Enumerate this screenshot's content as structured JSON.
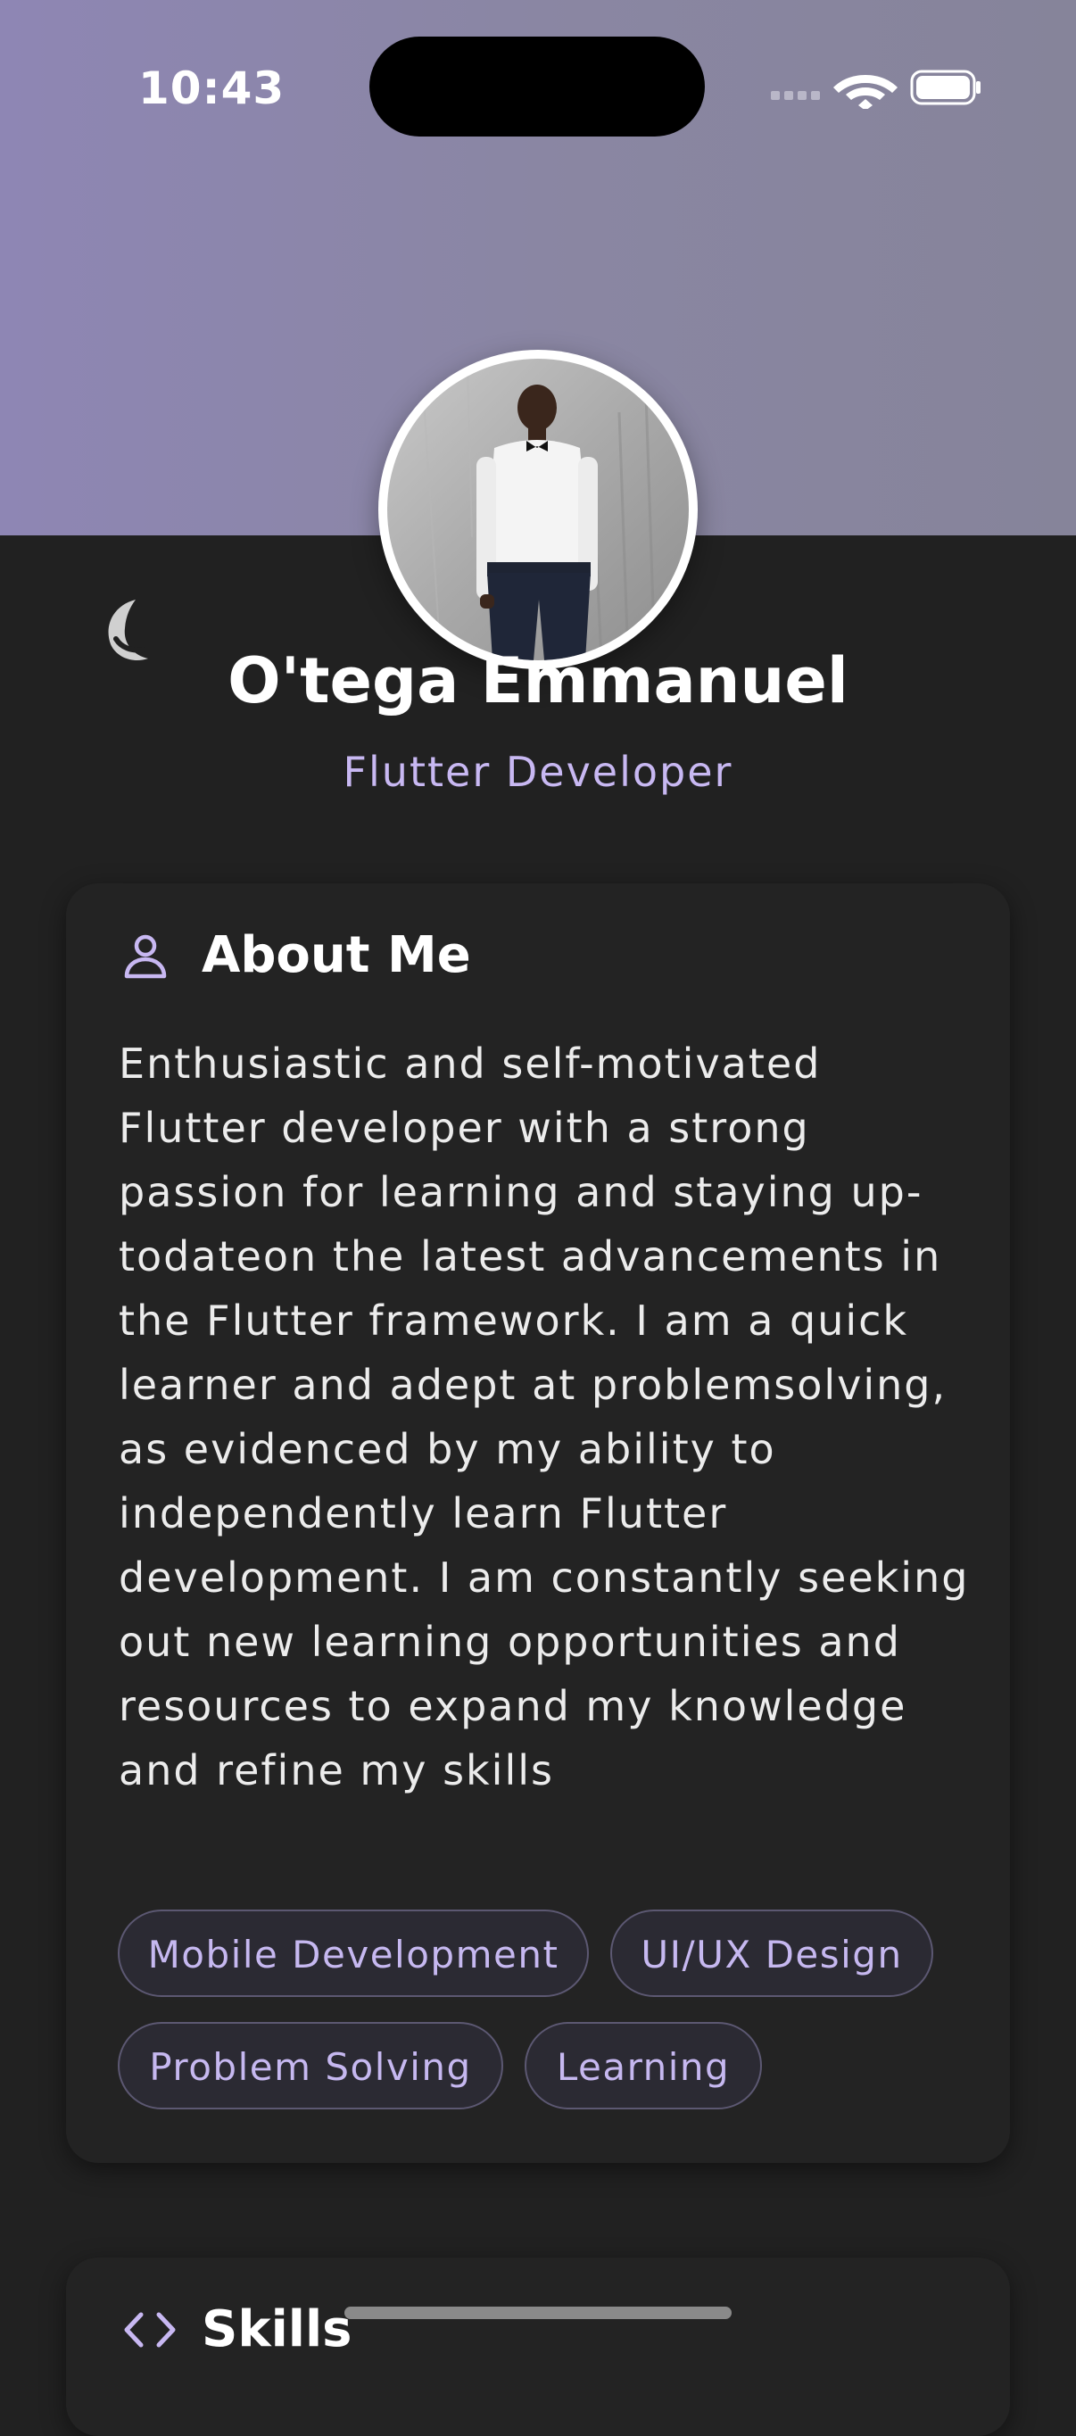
{
  "status_bar": {
    "time": "10:43"
  },
  "profile": {
    "name": "O'tega Emmanuel",
    "role": "Flutter Developer"
  },
  "about": {
    "title": "About Me",
    "icon": "person-icon",
    "text": "Enthusiastic and self-motivated Flutter developer with a strong passion for learning and staying up-todateon the latest advancements in the Flutter framework. I am a quick learner and adept at problemsolving, as evidenced by my ability to independently learn Flutter development. I am constantly seeking out new learning opportunities and resources to expand my knowledge and refine my skills",
    "tags": [
      "Mobile Development",
      "UI/UX Design",
      "Problem Solving",
      "Learning"
    ]
  },
  "skills": {
    "title": "Skills",
    "icon": "code-icon"
  },
  "theme": {
    "accent": "#c8b8f2",
    "background": "#212121",
    "header_gradient_start": "#8e86b4",
    "header_gradient_end": "#86849a"
  }
}
